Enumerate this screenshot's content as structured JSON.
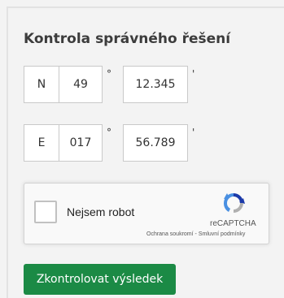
{
  "form": {
    "title": "Kontrola správného řešení",
    "latitude": {
      "hemisphere": "N",
      "degrees": "49",
      "degree_symbol": "°",
      "minutes": "12.345",
      "minute_symbol": "'"
    },
    "longitude": {
      "hemisphere": "E",
      "degrees": "017",
      "degree_symbol": "°",
      "minutes": "56.789",
      "minute_symbol": "'"
    },
    "submit_label": "Zkontrolovat výsledek"
  },
  "recaptcha": {
    "label": "Nejsem robot",
    "brand": "reCAPTCHA",
    "privacy_link": "Ochrana soukromí",
    "separator": " - ",
    "terms_link": "Smluvní podmínky"
  },
  "colors": {
    "accent": "#1b8a45",
    "recaptcha_blue": "#1c3aa9",
    "recaptcha_lightblue": "#4a90e2",
    "recaptcha_gray": "#b0b0b0"
  }
}
